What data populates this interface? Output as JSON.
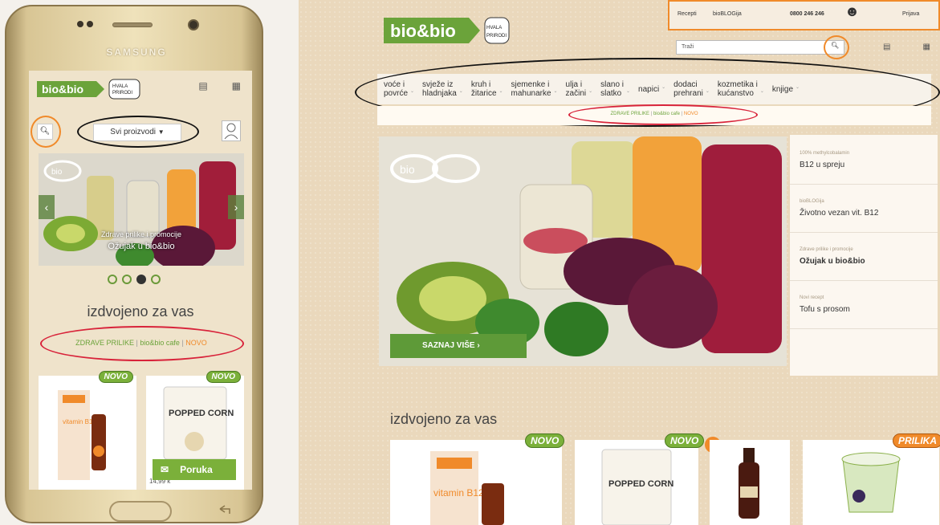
{
  "brand": {
    "logo_text": "bio&bio",
    "tagline_line1": "HVALA",
    "tagline_line2": "PRIRODI",
    "green": "#6ba33a",
    "orange": "#f08a2a"
  },
  "mobile": {
    "device_brand": "SAMSUNG",
    "category_select": "Svi proizvodi",
    "slider": {
      "overlay_logo": "bio",
      "caption_small": "Zdrave prilike i promocije",
      "caption_main": "Ožujak u bio&bio",
      "active_dot": 3,
      "dot_count": 4
    },
    "heading": "izdvojeno za vas",
    "links": [
      "ZDRAVE PRILIKE",
      "bio&bio cafe",
      "NOVO"
    ],
    "products": [
      {
        "badge": "NOVO",
        "name": "vitamin B12"
      },
      {
        "badge": "NOVO",
        "name": "POPPED CORN"
      }
    ],
    "message_button": "Poruka",
    "partial_price": "14,99 k"
  },
  "desktop": {
    "topbar": {
      "recepti": "Recepti",
      "bioblog": "bioBLOGija",
      "phone": "0800 246 246",
      "login": "Prijava"
    },
    "search_placeholder": "Traži",
    "nav": [
      {
        "l1": "voće i",
        "l2": "povrće"
      },
      {
        "l1": "svježe iz",
        "l2": "hladnjaka"
      },
      {
        "l1": "kruh i",
        "l2": "žitarice"
      },
      {
        "l1": "sjemenke i",
        "l2": "mahunarke"
      },
      {
        "l1": "ulja i",
        "l2": "začini"
      },
      {
        "l1": "slano i",
        "l2": "slatko"
      },
      {
        "l1": "napici",
        "l2": ""
      },
      {
        "l1": "dodaci",
        "l2": "prehrani"
      },
      {
        "l1": "kozmetika i",
        "l2": "kućanstvo"
      },
      {
        "l1": "knjige",
        "l2": ""
      }
    ],
    "sub_links": [
      "ZDRAVE PRILIKE",
      "bio&bio cafe",
      "NOVO"
    ],
    "hero_logo": "bio",
    "cta": "SAZNAJ VIŠE",
    "side_items": [
      {
        "small": "100% methylcobalamin",
        "main": "B12 u spreju"
      },
      {
        "small": "bioBLOGija",
        "main": "Životno vezan vit. B12"
      },
      {
        "small": "Zdrave prilike i promocije",
        "main": "Ožujak u bio&bio"
      },
      {
        "small": "Novi recept",
        "main": "Tofu s prosom"
      }
    ],
    "heading": "izdvojeno za vas",
    "products": [
      {
        "badge": "NOVO",
        "name": "vitamin B12"
      },
      {
        "badge": "NOVO",
        "name": "POPPED CORN"
      },
      {
        "badge": "",
        "name": ""
      },
      {
        "badge": "PRILIKA",
        "name": ""
      }
    ]
  }
}
